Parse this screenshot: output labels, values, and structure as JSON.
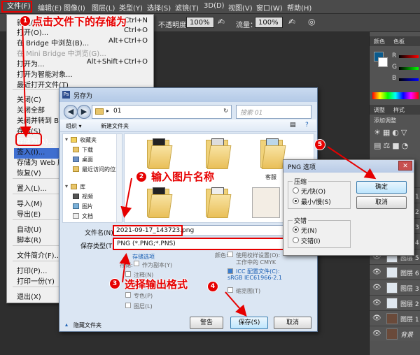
{
  "menubar": {
    "items": [
      "文件(F)",
      "编辑(E)",
      "图像(I)",
      "图层(L)",
      "类型(Y)",
      "选择(S)",
      "滤镜(T)",
      "3D(D)",
      "视图(V)",
      "窗口(W)",
      "帮助(H)"
    ]
  },
  "options": {
    "opacity_label": "不透明度：",
    "opacity_value": "100%",
    "flow_label": "流量：",
    "flow_value": "100%"
  },
  "file_menu": {
    "items": [
      {
        "label": "新建(N)...",
        "shortcut": "Ctrl+N"
      },
      {
        "label": "打开(O)...",
        "shortcut": "Ctrl+O"
      },
      {
        "label": "在 Bridge 中浏览(B)...",
        "shortcut": "Alt+Ctrl+O"
      },
      {
        "label": "在 Mini Bridge 中浏览(G)...",
        "shortcut": ""
      },
      {
        "label": "打开为...",
        "shortcut": "Alt+Shift+Ctrl+O"
      },
      {
        "label": "打开为智能对象...",
        "shortcut": ""
      },
      {
        "label": "最近打开文件(T)",
        "shortcut": ""
      },
      {
        "label": "关闭(C)",
        "shortcut": ""
      },
      {
        "label": "关闭全部",
        "shortcut": ""
      },
      {
        "label": "关闭并转到 Br",
        "shortcut": ""
      },
      {
        "label": "存储(S)",
        "shortcut": ""
      },
      {
        "label": "存储为(A)...",
        "shortcut": ""
      },
      {
        "label": "签入(I)...",
        "shortcut": ""
      },
      {
        "label": "存储为 Web 所",
        "shortcut": ""
      },
      {
        "label": "恢复(V)",
        "shortcut": ""
      },
      {
        "label": "置入(L)...",
        "shortcut": ""
      },
      {
        "label": "导入(M)",
        "shortcut": ""
      },
      {
        "label": "导出(E)",
        "shortcut": ""
      },
      {
        "label": "自动(U)",
        "shortcut": ""
      },
      {
        "label": "脚本(R)",
        "shortcut": ""
      },
      {
        "label": "文件简介(F)...",
        "shortcut": ""
      },
      {
        "label": "打印(P)...",
        "shortcut": ""
      },
      {
        "label": "打印一份(Y)",
        "shortcut": ""
      },
      {
        "label": "退出(X)",
        "shortcut": ""
      }
    ]
  },
  "save_dialog": {
    "title": "另存为",
    "path_segment": "01",
    "search_placeholder": "搜索 01",
    "organize": "组织 ▾",
    "new_folder": "新建文件夹",
    "nav": {
      "favorites": "收藏夹",
      "downloads": "下载",
      "desktop": "桌面",
      "recent": "最近访问的位置",
      "library": "库",
      "videos": "视频",
      "pictures": "图片",
      "documents": "文档"
    },
    "folder_caption": "客服",
    "filename_label": "文件名(N):",
    "filename_value": "2021-09-17_143723.png",
    "format_label": "保存类型(T):",
    "format_value": "PNG (*.PNG;*.PNS)",
    "save_options_link": "存储选项",
    "store_label": "存储:",
    "as_copy": "作为副本(Y)",
    "notes": "注释(N)",
    "alpha": "Alpha 通道(E)",
    "spot": "专色(P)",
    "layers": "图层(L)",
    "color_label": "颜色:",
    "use_proof": "使用校样设置(O):",
    "working_cmyk": "工作中的 CMYK",
    "icc": "ICC 配置文件(C):",
    "icc_profile": "sRGB IEC61966-2.1",
    "thumbnail": "缩览图(T)",
    "hide_folders": "隐藏文件夹",
    "btn_warning": "警告",
    "btn_save": "保存(S)",
    "btn_cancel": "取消"
  },
  "png_dialog": {
    "title": "PNG 选项",
    "compression_label": "压缩",
    "none_fast": "无/快(O)",
    "smallest_slow": "最小/慢(S)",
    "interlace_label": "交错",
    "interlace_none": "无(N)",
    "interlace_on": "交错(I)",
    "ok": "确定",
    "cancel": "取消"
  },
  "panels": {
    "color_tab": "颜色",
    "swatches_tab": "色板",
    "adjust_tab": "调整",
    "styles_tab": "样式",
    "add_adjust": "添加调整",
    "r": "R",
    "g": "G",
    "b": "B",
    "fg_color": "#0a5a8c",
    "layers": [
      "图层 1",
      "图层 2",
      "图层 3",
      "图层 4",
      "图层 5",
      "图层 6",
      "图层 3",
      "图层 2",
      "图层 1",
      "背景"
    ]
  },
  "annotations": {
    "step1": "点击文件下的存储为",
    "step2": "输入图片名称",
    "step3": "选择输出格式",
    "step5_num": "5",
    "step1_num": "1",
    "step2_num": "2",
    "step3_num": "3",
    "step4_num": "4",
    "accent": "#e60000"
  }
}
